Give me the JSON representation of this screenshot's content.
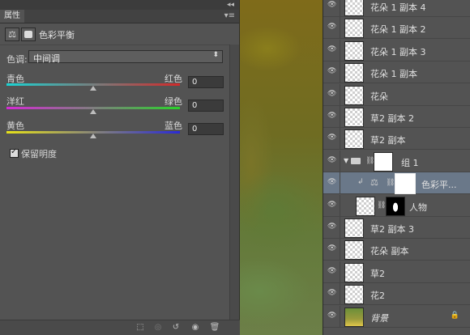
{
  "properties_panel": {
    "tab_label": "属性",
    "collapse_glyph": "◂◂",
    "menu_glyph": "▾≡",
    "header_title": "色彩平衡",
    "tone_label": "色调:",
    "tone_value": "中间调",
    "sliders": [
      {
        "left": "青色",
        "right": "红色",
        "value": "0",
        "level": 0
      },
      {
        "left": "洋红",
        "right": "绿色",
        "value": "0",
        "level": 0
      },
      {
        "left": "黄色",
        "right": "蓝色",
        "value": "0",
        "level": 0
      }
    ],
    "preserve_luminosity_label": "保留明度",
    "preserve_luminosity_checked": true
  },
  "layers_panel": {
    "layers": [
      {
        "name": "花朵 1 副本 4",
        "type": "pixel"
      },
      {
        "name": "花朵 1 副本 2",
        "type": "pixel"
      },
      {
        "name": "花朵 1 副本 3",
        "type": "pixel"
      },
      {
        "name": "花朵 1 副本",
        "type": "pixel"
      },
      {
        "name": "花朵",
        "type": "pixel"
      },
      {
        "name": "草2 副本 2",
        "type": "pixel"
      },
      {
        "name": "草2 副本",
        "type": "pixel"
      },
      {
        "name": "组 1",
        "type": "group"
      },
      {
        "name": "色彩平...",
        "type": "adjustment",
        "selected": true
      },
      {
        "name": "人物",
        "type": "masked"
      },
      {
        "name": "草2 副本 3",
        "type": "pixel"
      },
      {
        "name": "花朵 副本",
        "type": "pixel"
      },
      {
        "name": "草2",
        "type": "pixel"
      },
      {
        "name": "花2",
        "type": "pixel"
      },
      {
        "name": "背景",
        "type": "background"
      }
    ]
  },
  "colors": {
    "panel_bg": "#535353",
    "selected_row": "#6a7889"
  }
}
